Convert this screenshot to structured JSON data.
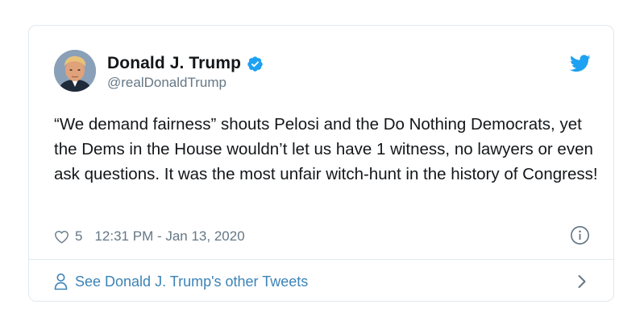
{
  "tweet": {
    "author": {
      "display_name": "Donald J. Trump",
      "handle": "@realDonaldTrump",
      "verified": true,
      "avatar_icon": "profile-photo"
    },
    "text": "“We demand fairness” shouts Pelosi and the Do Nothing Democrats, yet the Dems in the House wouldn’t let us have 1 witness, no lawyers or even ask questions. It was the most unfair witch-hunt in the history of Congress!",
    "likes": "5",
    "timestamp": "12:31 PM - Jan 13, 2020",
    "footer_link": "See Donald J. Trump's other Tweets"
  },
  "colors": {
    "verified_blue": "#1da1f2",
    "twitter_blue": "#1da1f2",
    "link_blue": "#3b83b6",
    "secondary_text": "#657786",
    "border": "#e1e8ed"
  },
  "icons": {
    "brand": "twitter-bird-icon",
    "like": "heart-icon",
    "info": "info-icon",
    "author_link": "person-icon",
    "footer_arrow": "chevron-right-icon"
  }
}
